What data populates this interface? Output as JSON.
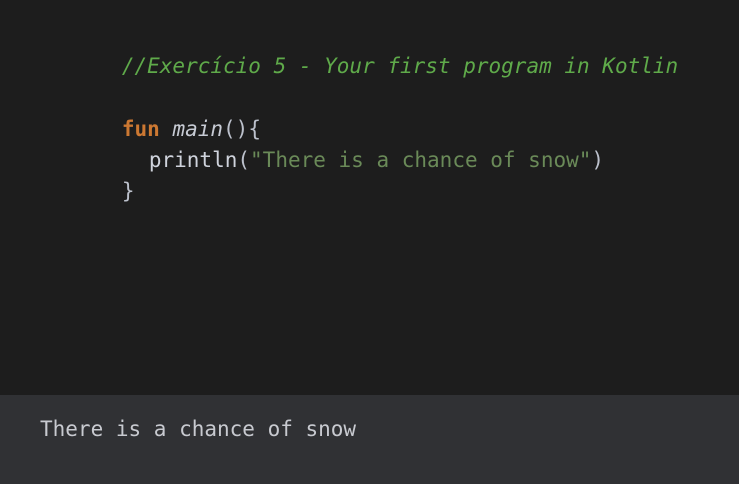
{
  "editor": {
    "comment": "//Exercício 5 - Your first program in Kotlin",
    "keyword_fun": "fun",
    "function_name": "main",
    "parens_open": "()",
    "brace_open": "{",
    "call_name": "println",
    "call_open": "(",
    "string_literal": "\"There is a chance of snow\"",
    "call_close": ")",
    "brace_close": "}"
  },
  "console": {
    "output": "There is a chance of snow"
  },
  "colors": {
    "editor_background": "#1d1d1d",
    "console_background": "#303134",
    "comment": "#5faa4a",
    "keyword": "#cc7832",
    "string": "#6a8a58"
  }
}
